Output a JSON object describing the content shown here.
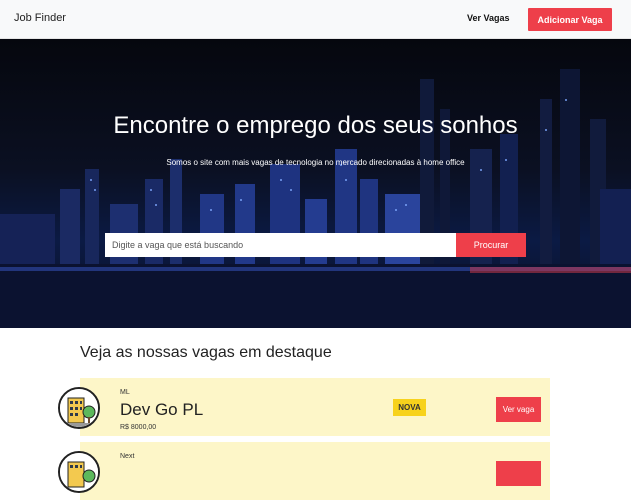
{
  "navbar": {
    "brand": "Job Finder",
    "link_label": "Ver Vagas",
    "add_button_label": "Adicionar Vaga"
  },
  "hero": {
    "title": "Encontre o emprego dos seus sonhos",
    "subtitle": "Somos o site com mais vagas de tecnologia no mercado direcionadas à home office",
    "search_placeholder": "Digite a vaga que está buscando",
    "search_button_label": "Procurar"
  },
  "featured": {
    "title": "Veja as nossas vagas em destaque",
    "jobs": [
      {
        "company": "ML",
        "title": "Dev Go PL",
        "salary": "R$ 8000,00",
        "badge": "NOVA",
        "button_label": "Ver vaga",
        "logo_icon": "building-icon"
      },
      {
        "company": "Next",
        "title": "",
        "salary": "",
        "badge": "",
        "button_label": "",
        "logo_icon": "building-icon"
      }
    ]
  },
  "colors": {
    "accent": "#ee3f4a",
    "card_background": "#fdf6c8",
    "badge_background": "#f7d21c"
  }
}
